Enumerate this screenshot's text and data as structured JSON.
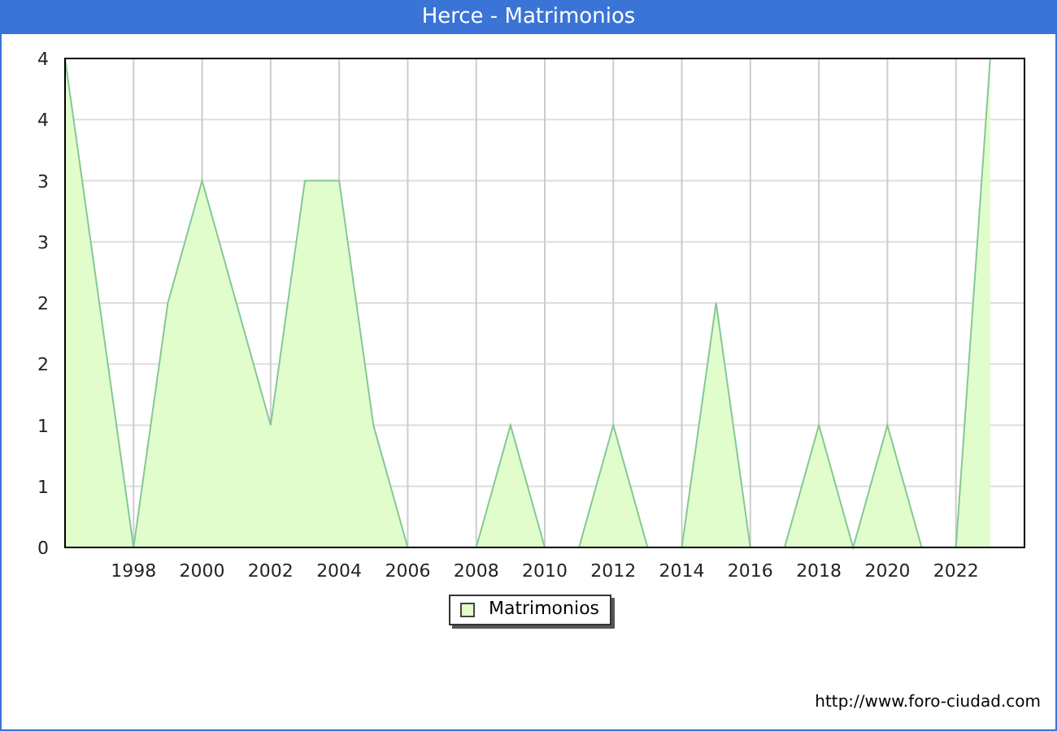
{
  "window": {
    "title": "Herce - Matrimonios"
  },
  "chart": {
    "chart_data": {
      "type": "area",
      "x": [
        1996,
        1997,
        1998,
        1999,
        2000,
        2001,
        2002,
        2003,
        2004,
        2005,
        2006,
        2007,
        2008,
        2009,
        2010,
        2011,
        2012,
        2013,
        2014,
        2015,
        2016,
        2017,
        2018,
        2019,
        2020,
        2021,
        2022,
        2023
      ],
      "series": [
        {
          "name": "Matrimonios",
          "color": "#e2fdcc",
          "values": [
            4,
            2,
            0,
            2,
            3,
            2,
            1,
            3,
            3,
            1,
            0,
            0,
            0,
            1,
            0,
            0,
            1,
            0,
            0,
            2,
            0,
            0,
            1,
            0,
            1,
            0,
            0,
            4
          ]
        }
      ],
      "grid": true,
      "xlim": [
        1996,
        2024
      ],
      "ylim": [
        0,
        4
      ],
      "xticks": [
        1998,
        2000,
        2002,
        2004,
        2006,
        2008,
        2010,
        2012,
        2014,
        2016,
        2018,
        2020,
        2022
      ],
      "yticks": [
        {
          "value": 0,
          "label": "0"
        },
        {
          "value": 0.5,
          "label": "1"
        },
        {
          "value": 1,
          "label": "1"
        },
        {
          "value": 1.5,
          "label": "2"
        },
        {
          "value": 2,
          "label": "2"
        },
        {
          "value": 2.5,
          "label": "3"
        },
        {
          "value": 3,
          "label": "3"
        },
        {
          "value": 3.5,
          "label": "4"
        },
        {
          "value": 4,
          "label": "4"
        }
      ]
    }
  },
  "footer": "http://www.foro-ciudad.com"
}
